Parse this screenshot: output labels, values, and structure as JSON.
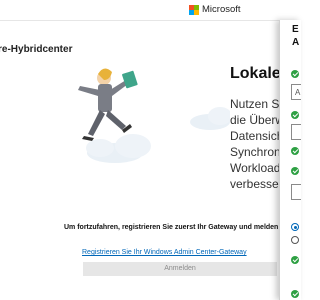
{
  "header": {
    "brand": "Microsoft"
  },
  "colors": {
    "ms_red": "#f25022",
    "ms_green": "#7fba00",
    "ms_blue": "#00a4ef",
    "ms_yellow": "#ffb900",
    "link": "#0067b8",
    "check_green": "#2ea043"
  },
  "page": {
    "title": "re-Hybridcenter",
    "heading": "Lokale S",
    "description_lines": [
      "Nutzen Sie",
      "die Überwa",
      "Datensiche",
      "Synchronis",
      "Workloads",
      "verbessern"
    ],
    "prompt": "Um fortzufahren, registrieren Sie zuerst Ihr Gateway und melden",
    "register_link": "Registrieren Sie Ihr Windows Admin Center-Gateway",
    "signin_button": "Anmelden"
  },
  "side_panel": {
    "title_line1": "E",
    "title_line2": "A",
    "field1_value": "A"
  }
}
